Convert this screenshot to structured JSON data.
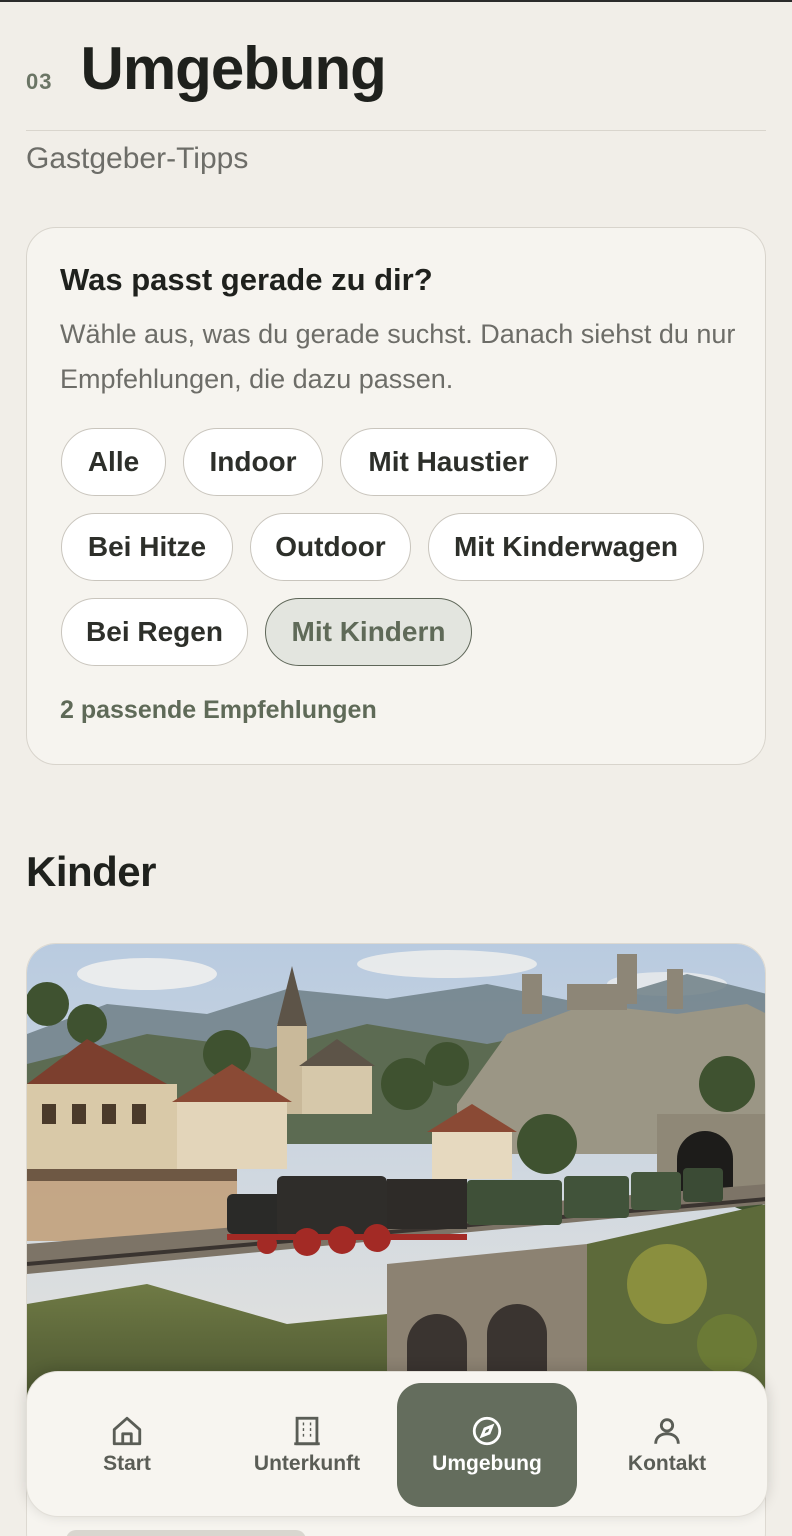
{
  "header": {
    "section_number": "03",
    "title": "Umgebung",
    "subtitle": "Gastgeber-Tipps"
  },
  "filter": {
    "question": "Was passt gerade zu dir?",
    "description": "Wähle aus, was du gerade suchst. Danach siehst du nur Empfehlungen, die dazu passen.",
    "chips": [
      {
        "label": "Alle",
        "active": false
      },
      {
        "label": "Indoor",
        "active": false
      },
      {
        "label": "Mit Haustier",
        "active": false
      },
      {
        "label": "Bei Hitze",
        "active": false
      },
      {
        "label": "Outdoor",
        "active": false
      },
      {
        "label": "Mit Kinderwagen",
        "active": false
      },
      {
        "label": "Bei Regen",
        "active": false
      },
      {
        "label": "Mit Kindern",
        "active": true
      }
    ],
    "match_count": "2 passende Empfehlungen"
  },
  "section": {
    "heading": "Kinder"
  },
  "recommendation": {
    "image_icon": "model-railway-photo"
  },
  "nav": {
    "items": [
      {
        "label": "Start",
        "icon": "home-icon",
        "active": false
      },
      {
        "label": "Unterkunft",
        "icon": "building-icon",
        "active": false
      },
      {
        "label": "Umgebung",
        "icon": "compass-icon",
        "active": true
      },
      {
        "label": "Kontakt",
        "icon": "person-icon",
        "active": false
      }
    ]
  },
  "colors": {
    "background": "#f1eee8",
    "accent": "#646d5d",
    "accent_text": "#5f6a58"
  }
}
